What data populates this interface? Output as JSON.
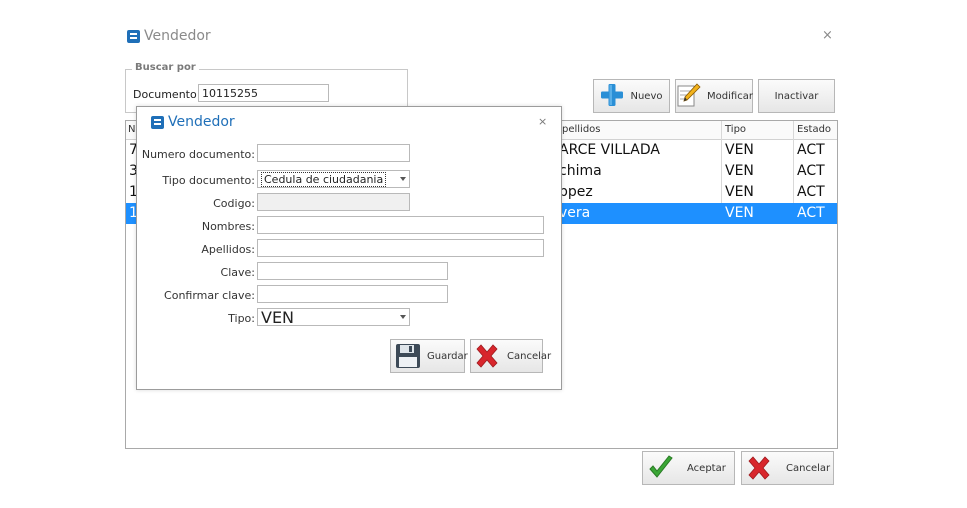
{
  "window": {
    "title": "Vendedor",
    "close": "×"
  },
  "search": {
    "legend": "Buscar por",
    "doc_label": "Documento:",
    "doc_value": "10115255"
  },
  "toolbar": {
    "new_label": "Nuevo",
    "modify_label": "Modificar",
    "inactivate_label": "Inactivar"
  },
  "grid": {
    "columns": [
      "N",
      "pellidos",
      "Tipo",
      "Estado"
    ],
    "rows": [
      {
        "num": "7",
        "apellidos": "ARCE VILLADA",
        "tipo": "VEN",
        "estado": "ACT",
        "selected": false
      },
      {
        "num": "3",
        "apellidos": "chima",
        "tipo": "VEN",
        "estado": "ACT",
        "selected": false
      },
      {
        "num": "1",
        "apellidos": "ppez",
        "tipo": "VEN",
        "estado": "ACT",
        "selected": false
      },
      {
        "num": "1",
        "apellidos": "vera",
        "tipo": "VEN",
        "estado": "ACT",
        "selected": true
      }
    ],
    "selected_color": "#1e90ff"
  },
  "footer": {
    "accept_label": "Aceptar",
    "cancel_label": "Cancelar"
  },
  "dialog": {
    "title": "Vendedor",
    "close": "×",
    "fields": {
      "numero_label": "Numero documento:",
      "numero_value": "",
      "tipo_doc_label": "Tipo documento:",
      "tipo_doc_value": "Cedula de ciudadania",
      "codigo_label": "Codigo:",
      "codigo_value": "",
      "nombres_label": "Nombres:",
      "nombres_value": "",
      "apellidos_label": "Apellidos:",
      "apellidos_value": "",
      "clave_label": "Clave:",
      "clave_value": "",
      "confirmar_label": "Confirmar clave:",
      "confirmar_value": "",
      "tipo_label": "Tipo:",
      "tipo_value": "VEN"
    },
    "save_label": "Guardar",
    "cancel_label": "Cancelar"
  },
  "icons": {
    "app": "app-logo-icon",
    "new": "plus-icon",
    "modify": "pencil-paper-icon",
    "save": "floppy-disk-icon",
    "cancel": "red-x-icon",
    "accept": "green-check-icon"
  },
  "colors": {
    "accent": "#1f6fb8",
    "plus": "#2a8fd6",
    "check": "#3aa635",
    "cross": "#d8262c"
  }
}
